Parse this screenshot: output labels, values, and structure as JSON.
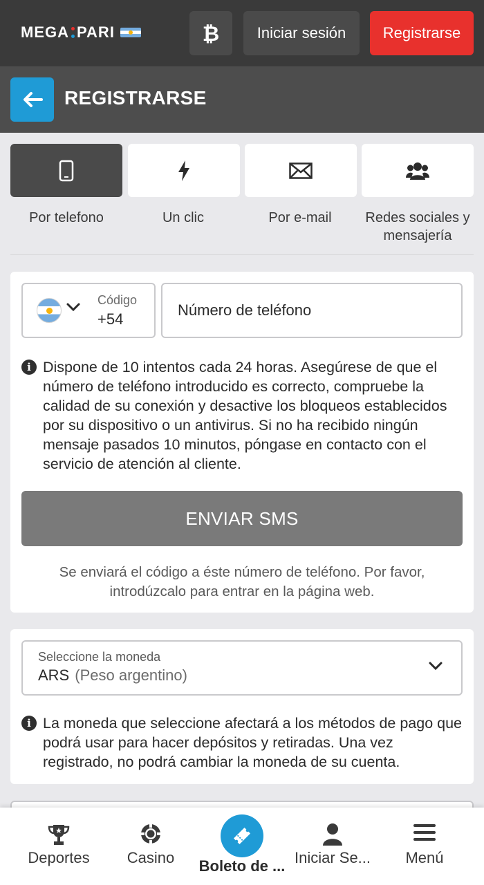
{
  "header": {
    "brand": "MEGA PARI",
    "brand_left": "MEGA",
    "brand_right": "PARI",
    "btc_icon": "bitcoin-icon",
    "login_label": "Iniciar sesión",
    "register_label": "Registrarse",
    "accent": "#e8312d"
  },
  "subheader": {
    "back_icon": "arrow-left-icon",
    "title": "REGISTRARSE",
    "accent": "#1f9bd6"
  },
  "methods": [
    {
      "label": "Por telefono",
      "icon": "mobile-phone-icon",
      "active": true
    },
    {
      "label": "Un clic",
      "icon": "lightning-icon",
      "active": false
    },
    {
      "label": "Por e-mail",
      "icon": "envelope-icon",
      "active": false
    },
    {
      "label": "Redes sociales y mensajería",
      "icon": "users-icon",
      "active": false
    }
  ],
  "phone_form": {
    "country_flag": "argentina-flag-icon",
    "code_label": "Código",
    "code_value": "+54",
    "phone_placeholder": "Número de teléfono",
    "phone_value": "",
    "info_text": "Dispone de 10 intentos cada 24 horas. Asegúrese de que el número de teléfono introducido es correcto, compruebe la calidad de su conexión y desactive los bloqueos establecidos por su dispositivo o un antivirus. Si no ha recibido ningún mensaje pasados 10 minutos, póngase en contacto con el servicio de atención al cliente.",
    "send_button": "ENVIAR SMS",
    "note": "Se enviará el código a éste número de teléfono. Por favor, introdúzcalo para entrar en la página web."
  },
  "currency_form": {
    "label": "Seleccione la moneda",
    "value_code": "ARS",
    "value_name": "(Peso argentino)",
    "info_text": "La moneda que seleccione afectará a los métodos de pago que podrá usar para hacer depósitos y retiradas. Una vez registrado, no podrá cambiar la moneda de su cuenta."
  },
  "bottom_nav": [
    {
      "label": "Deportes",
      "icon": "trophy-icon"
    },
    {
      "label": "Casino",
      "icon": "casino-chip-icon"
    },
    {
      "label": "Boleto de ...",
      "icon": "ticket-icon"
    },
    {
      "label": "Iniciar Se...",
      "icon": "user-icon"
    },
    {
      "label": "Menú",
      "icon": "hamburger-menu-icon"
    }
  ]
}
